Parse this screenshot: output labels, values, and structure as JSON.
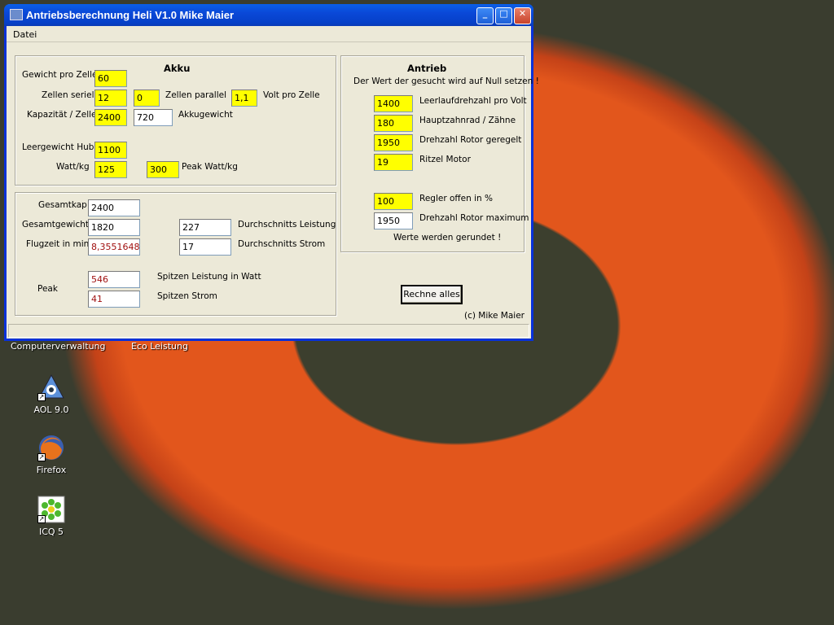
{
  "window": {
    "title": "Antriebsberechnung Heli V1.0 Mike Maier",
    "menu": [
      "Datei"
    ],
    "controls": {
      "minimize": "_",
      "maximize": "□",
      "close": "✕"
    }
  },
  "akku": {
    "heading": "Akku",
    "gewicht_label": "Gewicht pro Zelle",
    "gewicht_value": "60",
    "zellen_seriell_label": "Zellen seriell",
    "zellen_seriell_value": "12",
    "zellen_parallel_value": "0",
    "zellen_parallel_label": "Zellen parallel",
    "volt_value": "1,1",
    "volt_label": "Volt pro Zelle",
    "kapazitaet_label": "Kapazität / Zelle",
    "kapazitaet_value": "2400",
    "akkugewicht_value": "720",
    "akkugewicht_label": "Akkugewicht",
    "leergewicht_label": "Leergewicht Hubi",
    "leergewicht_value": "1100",
    "wattkg_label": "Watt/kg",
    "wattkg_value": "125",
    "peak_wattkg_value": "300",
    "peak_wattkg_label": "Peak Watt/kg"
  },
  "results": {
    "gesamtkap_label": "Gesamtkap",
    "gesamtkap_value": "2400",
    "gesamtgewicht_label": "Gesamtgewicht",
    "gesamtgewicht_value": "1820",
    "durchschnitt_leistung_value": "227",
    "durchschnitt_leistung_label": "Durchschnitts Leistung",
    "flugzeit_label": "Flugzeit in min",
    "flugzeit_value": "8,35516483",
    "durchschnitt_strom_value": "17",
    "durchschnitt_strom_label": "Durchschnitts Strom",
    "peak_label": "Peak",
    "spitzen_leistung_value": "546",
    "spitzen_leistung_label": "Spitzen Leistung in Watt",
    "spitzen_strom_value": "41",
    "spitzen_strom_label": "Spitzen Strom"
  },
  "antrieb": {
    "heading": "Antrieb",
    "hint": "Der Wert der gesucht wird auf Null setzen !",
    "leerlauf_value": "1400",
    "leerlauf_label": "Leerlaufdrehzahl pro Volt",
    "hauptzahnrad_value": "180",
    "hauptzahnrad_label": "Hauptzahnrad / Zähne",
    "drehzahl_geregelt_value": "1950",
    "drehzahl_geregelt_label": "Drehzahl Rotor geregelt",
    "ritzel_value": "19",
    "ritzel_label": "Ritzel Motor",
    "regler_value": "100",
    "regler_label": "Regler offen in %",
    "drehzahl_max_value": "1950",
    "drehzahl_max_label": "Drehzahl Rotor maximum",
    "rounded_note": "Werte werden gerundet !"
  },
  "actions": {
    "calculate": "Rechne alles"
  },
  "copyright": "(c) Mike Maier",
  "desktop": {
    "label_computerverwaltung": "Computerverwaltung",
    "label_eco": "Eco Leistung",
    "icons": [
      {
        "name": "AOL 9.0",
        "icon": "aol-icon"
      },
      {
        "name": "Firefox",
        "icon": "firefox-icon"
      },
      {
        "name": "ICQ 5",
        "icon": "icq-icon"
      }
    ]
  }
}
